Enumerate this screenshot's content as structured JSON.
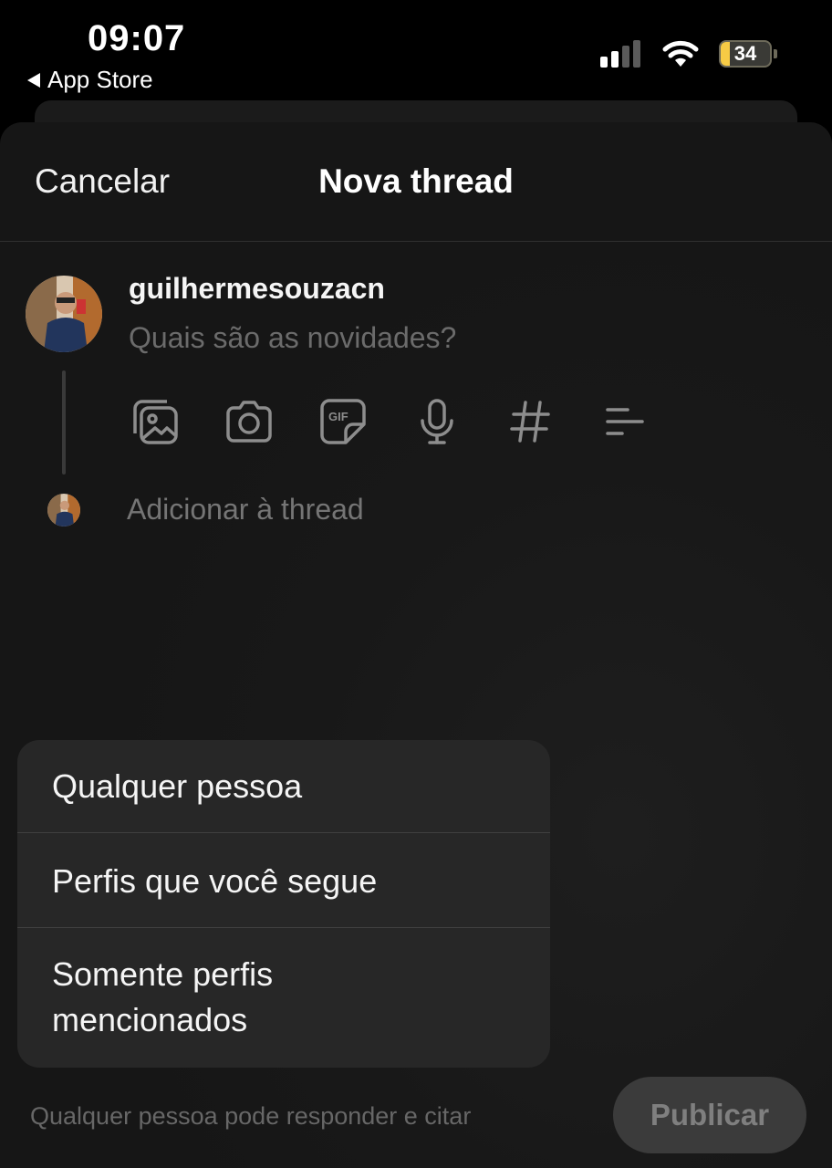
{
  "status_bar": {
    "time": "09:07",
    "back_label": "App Store",
    "battery_level": "34"
  },
  "header": {
    "cancel_label": "Cancelar",
    "title": "Nova thread"
  },
  "composer": {
    "username": "guilhermesouzacn",
    "placeholder": "Quais são as novidades?",
    "tools": [
      "gallery-icon",
      "camera-icon",
      "gif-icon",
      "microphone-icon",
      "hashtag-icon",
      "poll-icon"
    ],
    "add_thread_label": "Adicionar à thread"
  },
  "reply_menu": {
    "items": [
      "Qualquer pessoa",
      "Perfis que você segue",
      "Somente perfis mencionados"
    ]
  },
  "footer": {
    "reply_setting_text": "Qualquer pessoa pode responder e citar",
    "publish_label": "Publicar"
  },
  "colors": {
    "background": "#181818",
    "menu": "#272727",
    "battery_fill": "#f7cb45"
  }
}
